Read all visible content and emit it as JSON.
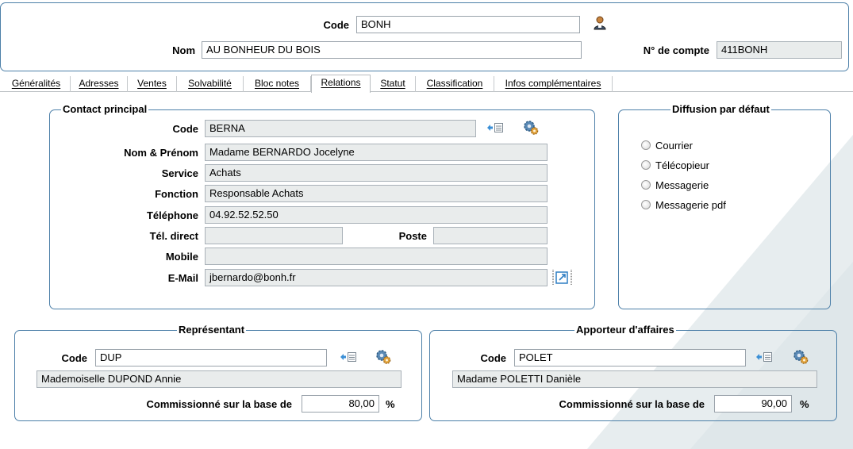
{
  "header": {
    "code_label": "Code",
    "code_value": "BONH",
    "nom_label": "Nom",
    "nom_value": "AU BONHEUR DU BOIS",
    "compte_label": "N° de compte",
    "compte_value": "411BONH"
  },
  "tabs": [
    {
      "label": "Généralités",
      "active": false
    },
    {
      "label": "Adresses",
      "active": false
    },
    {
      "label": "Ventes",
      "active": false
    },
    {
      "label": "Solvabilité",
      "active": false
    },
    {
      "label": "Bloc notes",
      "active": false
    },
    {
      "label": "Relations",
      "active": true
    },
    {
      "label": "Statut",
      "active": false
    },
    {
      "label": "Classification",
      "active": false
    },
    {
      "label": "Infos complémentaires",
      "active": false
    }
  ],
  "contact": {
    "title": "Contact principal",
    "code_label": "Code",
    "code_value": "BERNA",
    "nom_label": "Nom & Prénom",
    "nom_value": "Madame BERNARDO Jocelyne",
    "service_label": "Service",
    "service_value": "Achats",
    "fonction_label": "Fonction",
    "fonction_value": "Responsable Achats",
    "tel_label": "Téléphone",
    "tel_value": "04.92.52.52.50",
    "teldirect_label": "Tél. direct",
    "teldirect_value": "",
    "poste_label": "Poste",
    "poste_value": "",
    "mobile_label": "Mobile",
    "mobile_value": "",
    "email_label": "E-Mail",
    "email_value": "jbernardo@bonh.fr"
  },
  "diffusion": {
    "title": "Diffusion par défaut",
    "options": [
      "Courrier",
      "Télécopieur",
      "Messagerie",
      "Messagerie pdf"
    ]
  },
  "representant": {
    "title": "Représentant",
    "code_label": "Code",
    "code_value": "DUP",
    "name_value": "Mademoiselle DUPOND Annie",
    "commission_label": "Commissionné sur la base de",
    "commission_value": "80,00",
    "percent": "%"
  },
  "apporteur": {
    "title": "Apporteur d'affaires",
    "code_label": "Code",
    "code_value": "POLET",
    "name_value": "Madame POLETTI Danièle",
    "commission_label": "Commissionné sur la base de",
    "commission_value": "90,00",
    "percent": "%"
  },
  "colors": {
    "border": "#4c7fa8",
    "field_bg": "#e9ecec",
    "deco": "#e3eaed"
  }
}
